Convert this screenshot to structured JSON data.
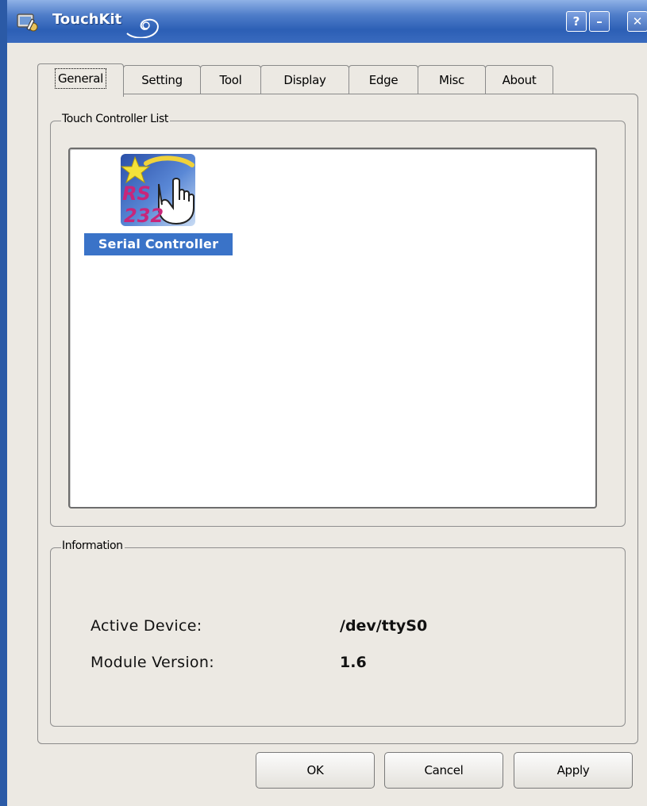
{
  "window": {
    "title": "TouchKit",
    "help_button": "?",
    "minimize_button": "–",
    "close_button": "✕"
  },
  "tabs": [
    {
      "label": "General",
      "active": true
    },
    {
      "label": "Setting"
    },
    {
      "label": "Tool"
    },
    {
      "label": "Display"
    },
    {
      "label": "Edge"
    },
    {
      "label": "Misc"
    },
    {
      "label": "About"
    }
  ],
  "controller_list": {
    "legend": "Touch Controller List",
    "items": [
      {
        "label": "Serial Controller",
        "icon": "rs232-touch-icon",
        "icon_text_top": "RS",
        "icon_text_bottom": "232",
        "selected": true
      }
    ]
  },
  "information": {
    "legend": "Information",
    "active_device_label": "Active Device:",
    "active_device_value": "/dev/ttyS0",
    "module_version_label": "Module Version:",
    "module_version_value": "1.6"
  },
  "buttons": {
    "ok": "OK",
    "cancel": "Cancel",
    "apply": "Apply"
  },
  "colors": {
    "titlebar": "#2c5fb5",
    "selection": "#3a73c8",
    "window_bg": "#ece9e3"
  }
}
